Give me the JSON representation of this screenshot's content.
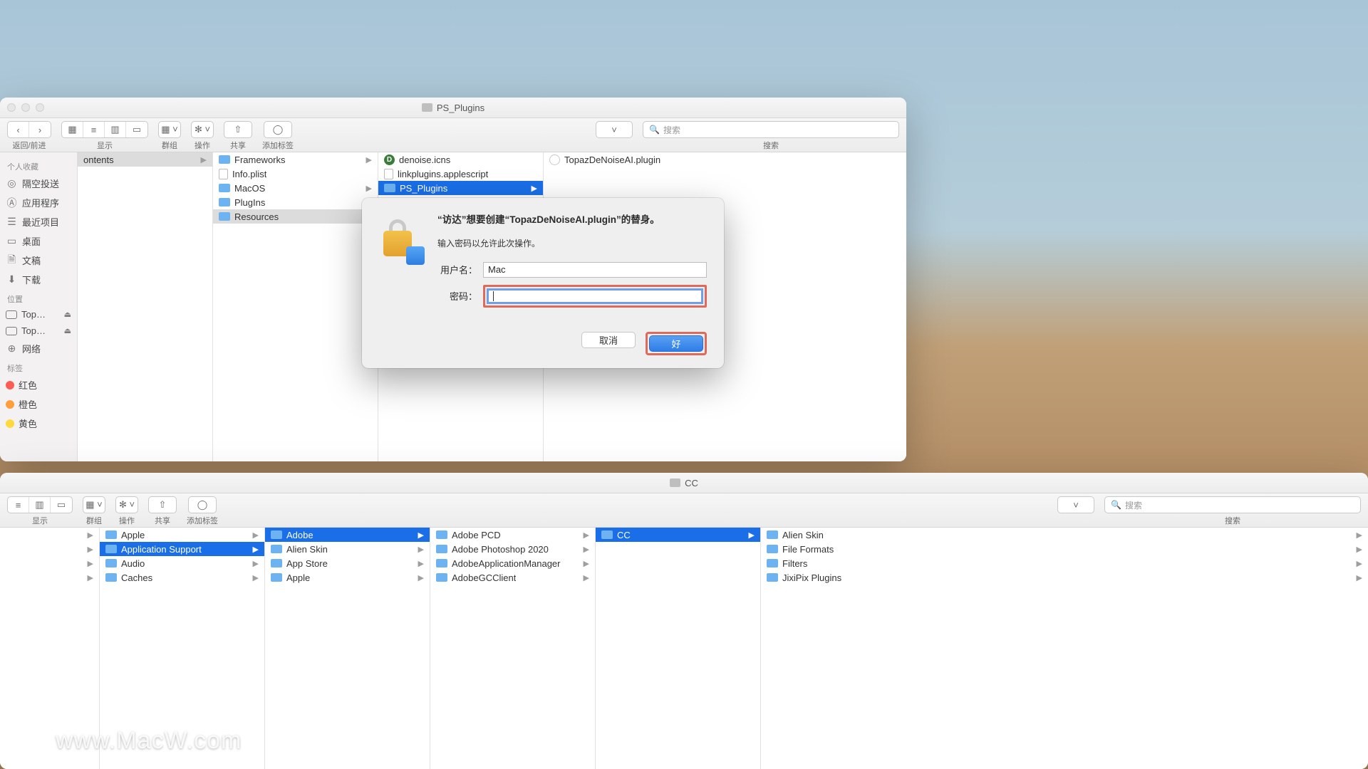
{
  "front_window": {
    "title": "PS_Plugins",
    "toolbar": {
      "nav_label": "返回/前进",
      "view_label": "显示",
      "group_label": "群组",
      "action_label": "操作",
      "share_label": "共享",
      "tags_label": "添加标签",
      "search_label": "搜索",
      "search_placeholder": "搜索"
    },
    "sidebar": {
      "favorites_header": "个人收藏",
      "items": [
        {
          "label": "隔空投送",
          "icon": "airdrop"
        },
        {
          "label": "应用程序",
          "icon": "apps"
        },
        {
          "label": "最近项目",
          "icon": "recents"
        },
        {
          "label": "桌面",
          "icon": "desktop"
        },
        {
          "label": "文稿",
          "icon": "docs"
        },
        {
          "label": "下载",
          "icon": "downloads"
        }
      ],
      "locations_header": "位置",
      "locations": [
        {
          "label": "Top…",
          "eject": true
        },
        {
          "label": "Top…",
          "eject": true
        },
        {
          "label": "网络",
          "icon": "network"
        }
      ],
      "tags_header": "标签",
      "tags": [
        {
          "label": "红色",
          "color": "#ff5b55"
        },
        {
          "label": "橙色",
          "color": "#ff9e3d"
        },
        {
          "label": "黄色",
          "color": "#ffd93d"
        }
      ]
    },
    "col1": {
      "items": [
        {
          "label": "Contents",
          "sel": true,
          "arrow": true,
          "partial": "ontents"
        }
      ]
    },
    "col2": {
      "items": [
        {
          "label": "Frameworks",
          "type": "folder",
          "arrow": true
        },
        {
          "label": "Info.plist",
          "type": "doc"
        },
        {
          "label": "MacOS",
          "type": "folder",
          "arrow": true
        },
        {
          "label": "PlugIns",
          "type": "folder",
          "arrow": true
        },
        {
          "label": "Resources",
          "type": "folder",
          "arrow": true,
          "sel": true
        }
      ]
    },
    "col3": {
      "items": [
        {
          "label": "denoise.icns",
          "type": "d"
        },
        {
          "label": "linkplugins.applescript",
          "type": "doc"
        },
        {
          "label": "PS_Plugins",
          "type": "folder",
          "arrow": true,
          "hl": true
        }
      ]
    },
    "col4": {
      "items": [
        {
          "label": "TopazDeNoiseAI.plugin",
          "type": "plugin"
        }
      ]
    }
  },
  "dialog": {
    "title": "“访达”想要创建“TopazDeNoiseAI.plugin”的替身。",
    "subtitle": "输入密码以允许此次操作。",
    "username_label": "用户名：",
    "username_value": "Mac",
    "password_label": "密码：",
    "password_value": "",
    "cancel": "取消",
    "ok": "好"
  },
  "back_window": {
    "title": "CC",
    "toolbar": {
      "view_label": "显示",
      "group_label": "群组",
      "action_label": "操作",
      "share_label": "共享",
      "tags_label": "添加标签",
      "search_label": "搜索",
      "search_placeholder": "搜索"
    },
    "col1": [
      {
        "label": "Apple",
        "arrow": true
      },
      {
        "label": "Application Support",
        "arrow": true,
        "hl": true
      },
      {
        "label": "Audio",
        "arrow": true
      },
      {
        "label": "Caches",
        "arrow": true
      }
    ],
    "col2": [
      {
        "label": "Adobe",
        "arrow": true,
        "hl": true
      },
      {
        "label": "Alien Skin",
        "arrow": true
      },
      {
        "label": "App Store",
        "arrow": true
      },
      {
        "label": "Apple",
        "arrow": true
      }
    ],
    "col3": [
      {
        "label": "Adobe PCD",
        "arrow": true
      },
      {
        "label": "Adobe Photoshop 2020",
        "arrow": true
      },
      {
        "label": "AdobeApplicationManager",
        "arrow": true
      },
      {
        "label": "AdobeGCClient",
        "arrow": true
      }
    ],
    "col4": [
      {
        "label": "CC",
        "arrow": true,
        "hl": true
      }
    ],
    "col5": [
      {
        "label": "Alien Skin",
        "arrow": true
      },
      {
        "label": "File Formats",
        "arrow": true
      },
      {
        "label": "Filters",
        "arrow": true
      },
      {
        "label": "JixiPix Plugins",
        "arrow": true
      }
    ]
  },
  "watermark": "www.MacW.com"
}
